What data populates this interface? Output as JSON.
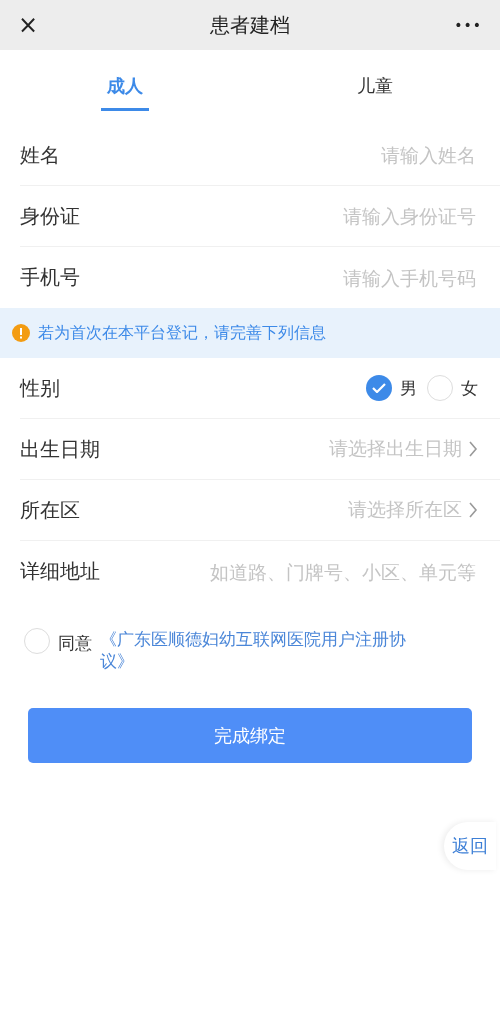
{
  "header": {
    "title": "患者建档",
    "close": "×",
    "more": "•••"
  },
  "tabs": [
    {
      "label": "成人",
      "selected": true
    },
    {
      "label": "儿童",
      "selected": false
    }
  ],
  "basic_fields": [
    {
      "kind": "input",
      "label": "姓名",
      "placeholder": "请输入姓名"
    },
    {
      "kind": "input",
      "label": "身份证",
      "placeholder": "请输入身份证号"
    },
    {
      "kind": "input",
      "label": "手机号",
      "placeholder": "请输入手机号码"
    }
  ],
  "notice": {
    "text": "若为首次在本平台登记，请完善下列信息"
  },
  "detail_fields": [
    {
      "kind": "radio",
      "label": "性别",
      "options": [
        {
          "label": "男",
          "selected": true
        },
        {
          "label": "女",
          "selected": false
        }
      ]
    },
    {
      "kind": "select",
      "label": "出生日期",
      "placeholder": "请选择出生日期"
    },
    {
      "kind": "select",
      "label": "所在区",
      "placeholder": "请选择所在区"
    },
    {
      "kind": "input",
      "label": "详细地址",
      "placeholder": "如道路、门牌号、小区、单元等"
    }
  ],
  "agreement": {
    "checked": false,
    "prefix": "同意",
    "link": "《广东医顺德妇幼互联网医院用户注册协议》"
  },
  "submit": "完成绑定",
  "float_button": "返回"
}
